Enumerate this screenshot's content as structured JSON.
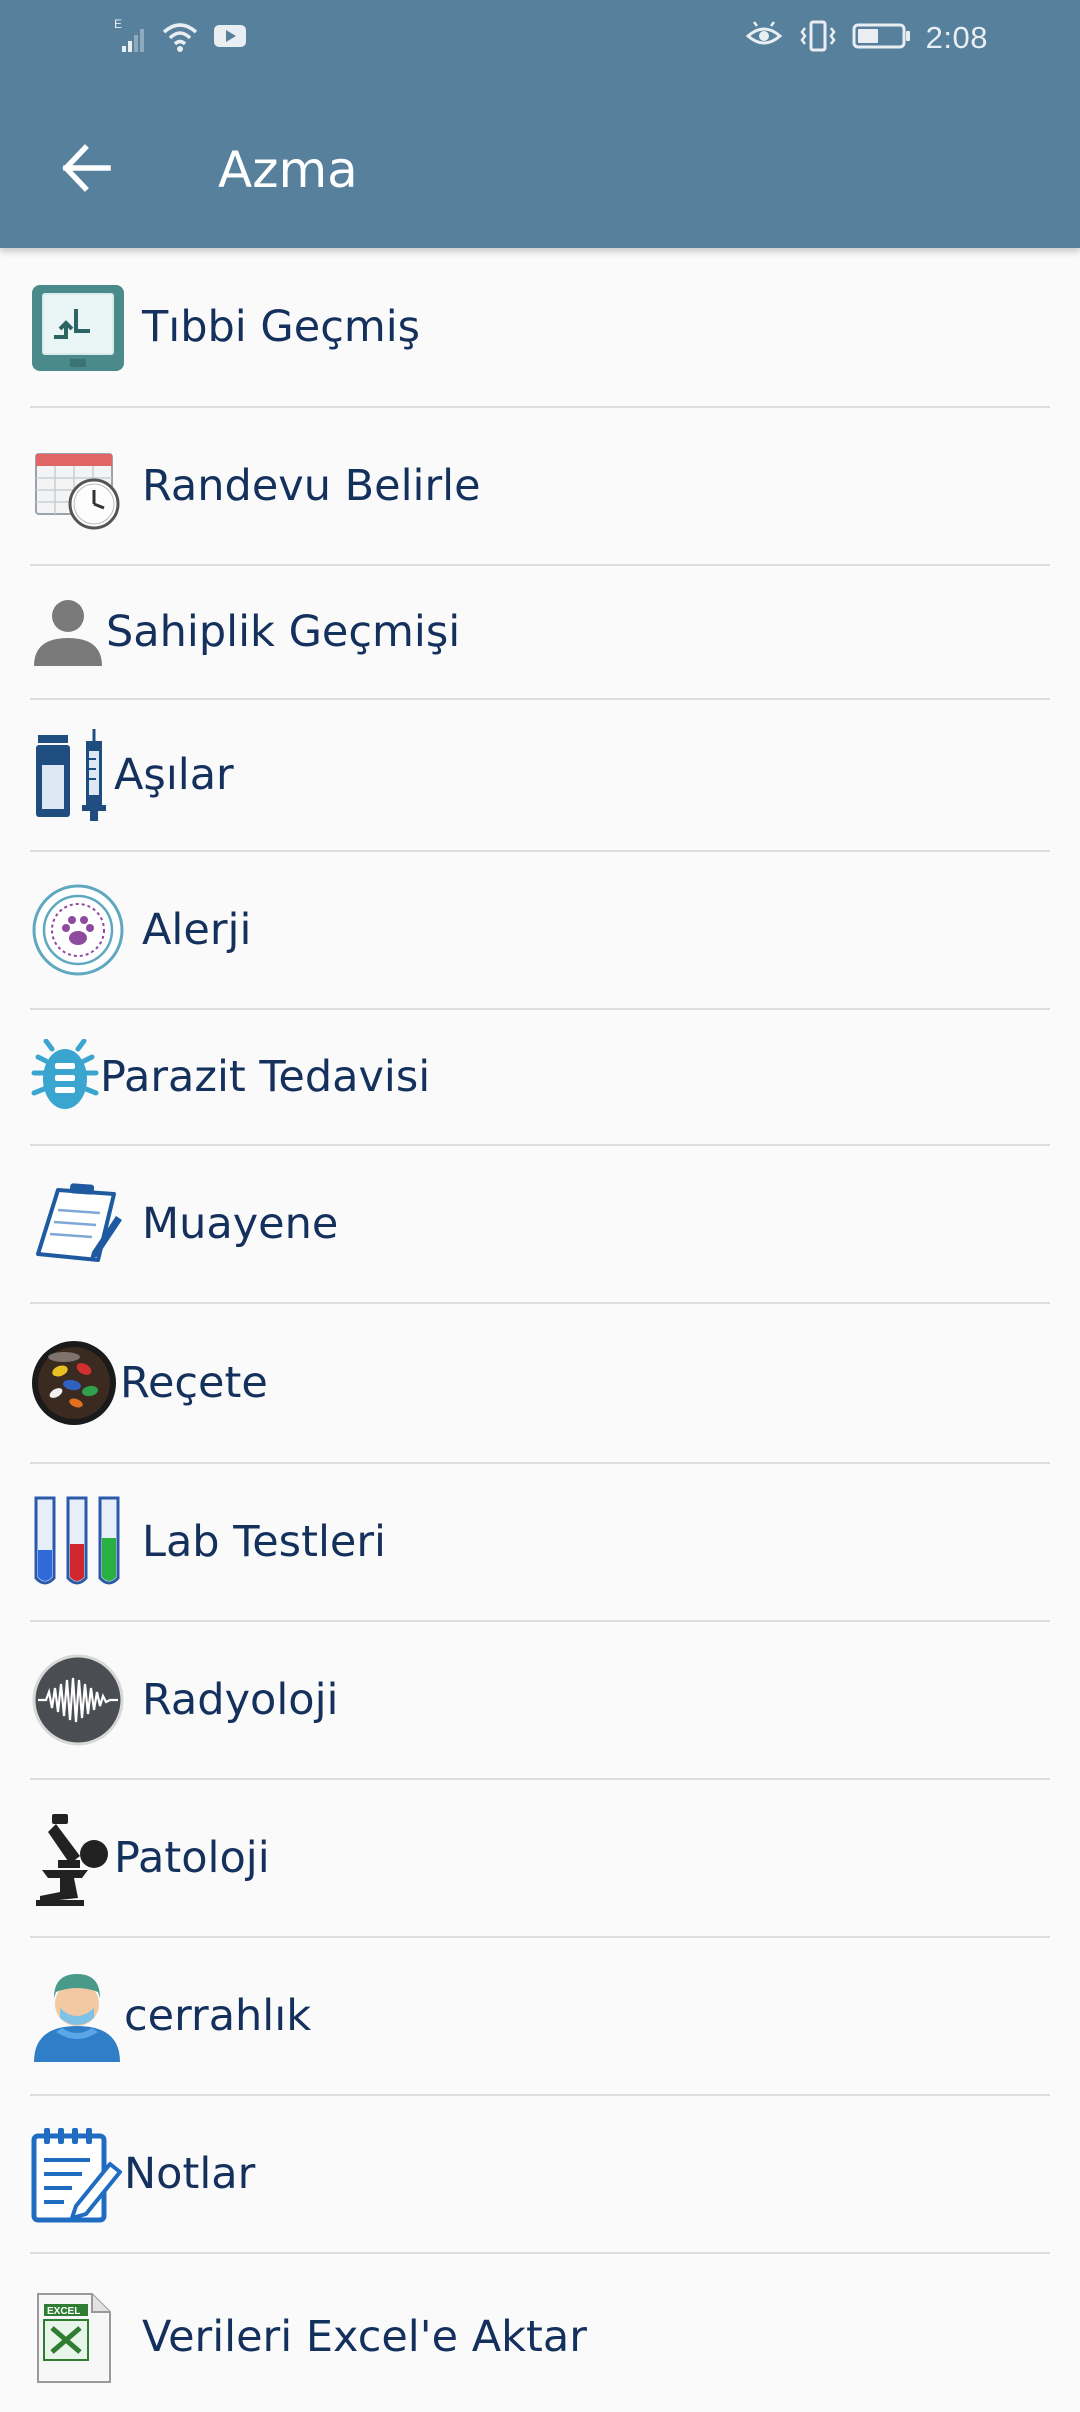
{
  "status_bar": {
    "time": "2:08",
    "signal_label": "E",
    "icons": [
      "signal-icon",
      "wifi-icon",
      "youtube-icon",
      "eye-comfort-icon",
      "vibrate-icon",
      "battery-icon"
    ]
  },
  "app_bar": {
    "title": "Azma",
    "back_icon": "arrow-back-icon"
  },
  "colors": {
    "header": "#56809c",
    "background": "#fafafa",
    "label": "#14305c",
    "divider": "#dedede"
  },
  "menu": {
    "items": [
      {
        "label": "Tıbbi Geçmiş",
        "icon": "medical-history-icon"
      },
      {
        "label": "Randevu Belirle",
        "icon": "calendar-clock-icon"
      },
      {
        "label": "Sahiplik Geçmişi",
        "icon": "person-icon"
      },
      {
        "label": "Aşılar",
        "icon": "vaccine-icon"
      },
      {
        "label": "Alerji",
        "icon": "paw-allergy-icon"
      },
      {
        "label": "Parazit Tedavisi",
        "icon": "bug-icon"
      },
      {
        "label": "Muayene",
        "icon": "clipboard-pen-icon"
      },
      {
        "label": "Reçete",
        "icon": "pills-icon"
      },
      {
        "label": "Lab Testleri",
        "icon": "test-tubes-icon"
      },
      {
        "label": "Radyoloji",
        "icon": "waveform-icon"
      },
      {
        "label": "Patoloji",
        "icon": "microscope-icon"
      },
      {
        "label": "cerrahlık",
        "icon": "surgeon-icon"
      },
      {
        "label": "Notlar",
        "icon": "notes-icon"
      },
      {
        "label": "Verileri Excel'e Aktar",
        "icon": "excel-icon"
      }
    ]
  }
}
